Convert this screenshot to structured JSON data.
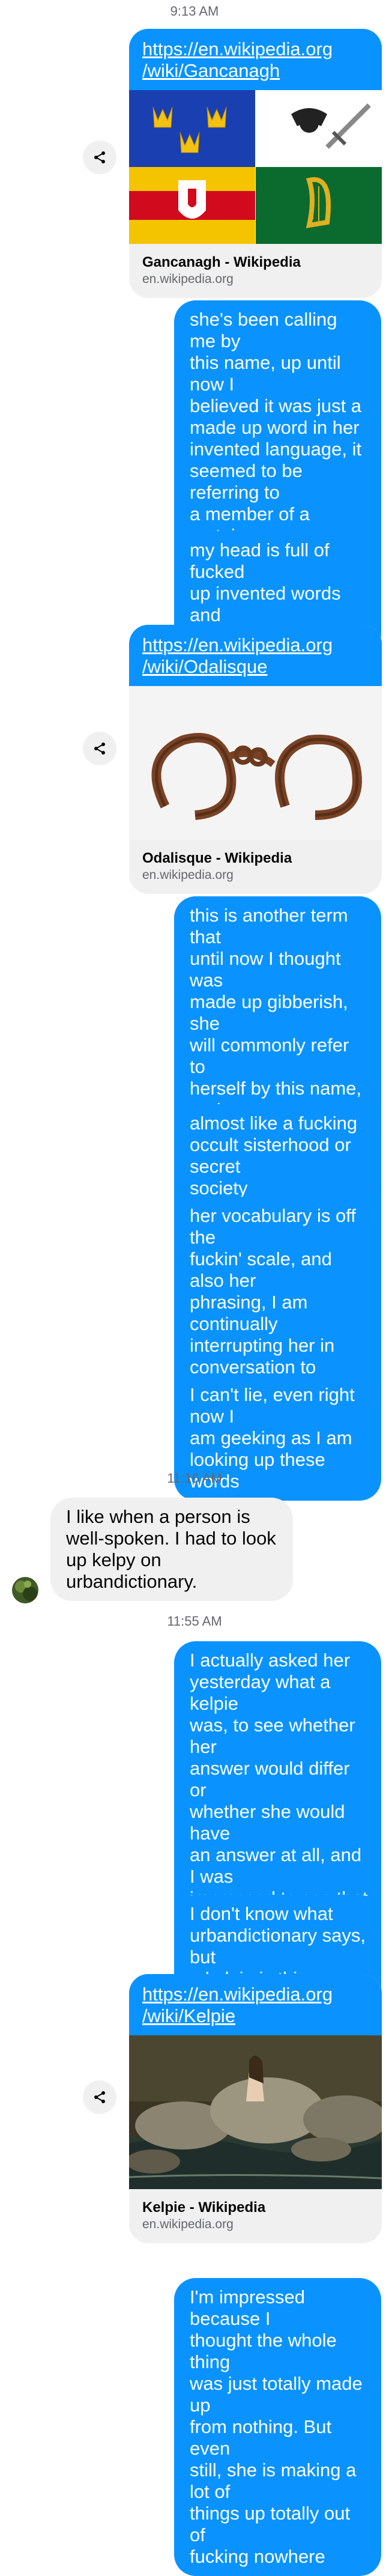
{
  "timestamps": [
    "9:13 AM",
    "11:16 AM",
    "11:55 AM"
  ],
  "cards": [
    {
      "url": "https://en.wikipedia.org\n/wiki/Gancanagh",
      "title": "Gancanagh - Wikipedia",
      "domain": "en.wikipedia.org"
    },
    {
      "url": "https://en.wikipedia.org\n/wiki/Odalisque",
      "title": "Odalisque - Wikipedia",
      "domain": "en.wikipedia.org"
    },
    {
      "url": "https://en.wikipedia.org\n/wiki/Kelpie",
      "title": "Kelpie - Wikipedia",
      "domain": "en.wikipedia.org"
    }
  ],
  "messages": [
    "she's been calling me by\nthis name, up until now I\nbelieved it was just a\nmade up word in her\ninvented language, it\nseemed to be referring to\na member of a certain\nspecies or group,\nsomething spiritual",
    "my head is full of fucked\nup invented words and\nterminologies",
    "this is another term that\nuntil now I thought was\nmade up gibberish, she\nwill commonly refer to\nherself by this name, and\nagain I had gleaned that\nshe seemed to be\ndescribing a member of a\ncertain species or group",
    "almost like a fucking\noccult sisterhood or secret\nsociety",
    "her vocabulary is off the\nfuckin' scale, and also her\nphrasing, I am continually\ninterrupting her in\nconversation to commend\nher on her impressive use\nof words",
    "I can't lie, even right now I\nam geeking as I am\nlooking up these words",
    "I like when a person is\nwell-spoken. I had to look\nup kelpy on\nurbandictionary.",
    "I actually asked her\nyesterday what a kelpie\nwas, to see whether her\nanswer would differ or\nwhether she would have\nan answer at all, and I was\nimpressed to see that she\ngave me the same general\nstory again, even without\nremembering that she had\nsaid it to me the first time",
    "I don't know what\nurbandictionary says, but\na kelpie is this",
    "I'm impressed because I\nthought the whole thing\nwas just totally made up\nfrom nothing. But even\nstill, she is making a lot of\nthings up totally out of\nfucking nowhere"
  ],
  "colors": {
    "sent": "#0a93ff",
    "received": "#f0f0f0",
    "timestamp": "#65676b"
  },
  "icons": [
    "share-icon",
    "share-icon",
    "share-icon",
    "contact-avatar"
  ]
}
